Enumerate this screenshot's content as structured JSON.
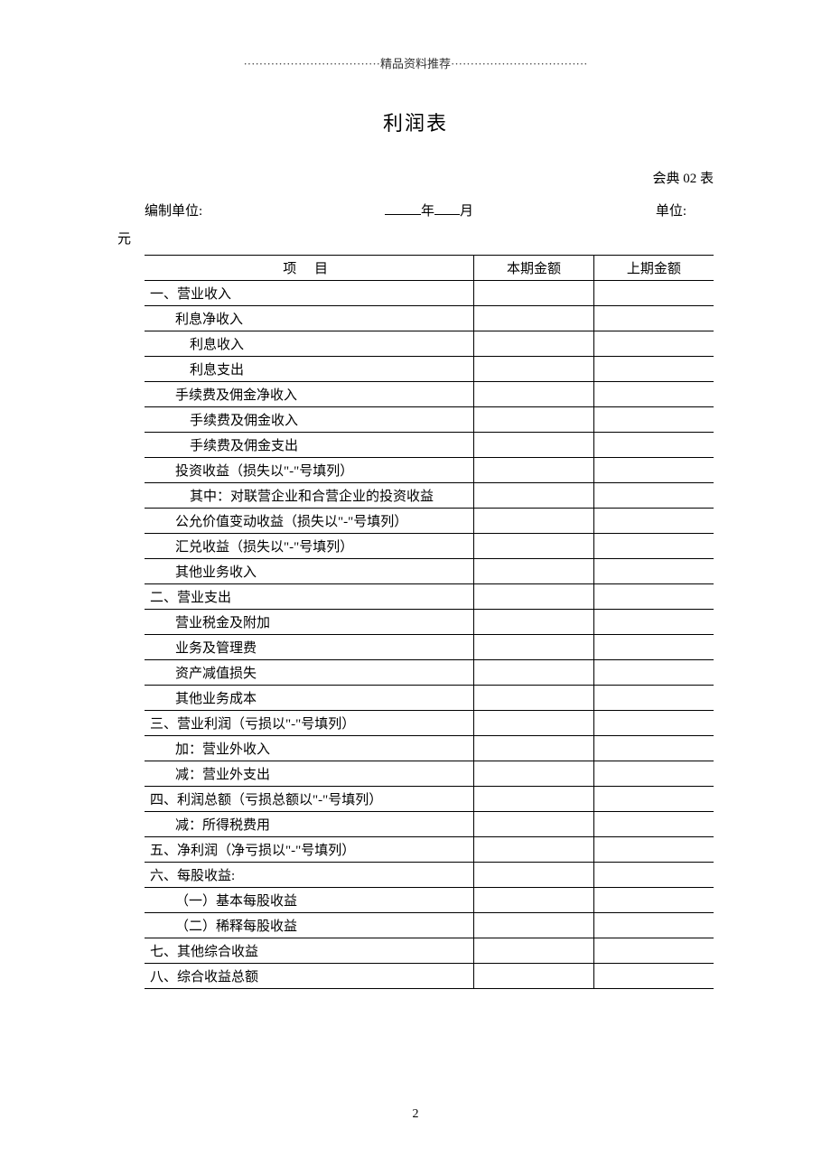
{
  "header_banner": "···································精品资料推荐···································",
  "title": "利润表",
  "form_code": "会典 02 表",
  "meta": {
    "prepared_by_label": "编制单位:",
    "year_label": "年",
    "month_label": "月",
    "unit_label": "单位:"
  },
  "currency_unit": "元",
  "table": {
    "headers": {
      "item": "项 目",
      "current": "本期金额",
      "prior": "上期金额"
    },
    "rows": [
      {
        "label": "一、营业收入",
        "indent": 0,
        "current": "",
        "prior": ""
      },
      {
        "label": "利息净收入",
        "indent": 1,
        "current": "",
        "prior": ""
      },
      {
        "label": "利息收入",
        "indent": 2,
        "current": "",
        "prior": ""
      },
      {
        "label": "利息支出",
        "indent": 2,
        "current": "",
        "prior": ""
      },
      {
        "label": "手续费及佣金净收入",
        "indent": 1,
        "current": "",
        "prior": ""
      },
      {
        "label": "手续费及佣金收入",
        "indent": 2,
        "current": "",
        "prior": ""
      },
      {
        "label": "手续费及佣金支出",
        "indent": 2,
        "current": "",
        "prior": ""
      },
      {
        "label": "投资收益（损失以\"-\"号填列）",
        "indent": 1,
        "current": "",
        "prior": ""
      },
      {
        "label": "其中：对联营企业和合营企业的投资收益",
        "indent": 2,
        "current": "",
        "prior": ""
      },
      {
        "label": "公允价值变动收益（损失以\"-\"号填列）",
        "indent": 1,
        "current": "",
        "prior": ""
      },
      {
        "label": "汇兑收益（损失以\"-\"号填列）",
        "indent": 1,
        "current": "",
        "prior": ""
      },
      {
        "label": "其他业务收入",
        "indent": 1,
        "current": "",
        "prior": ""
      },
      {
        "label": "二、营业支出",
        "indent": 0,
        "current": "",
        "prior": ""
      },
      {
        "label": "营业税金及附加",
        "indent": 1,
        "current": "",
        "prior": ""
      },
      {
        "label": "业务及管理费",
        "indent": 1,
        "current": "",
        "prior": ""
      },
      {
        "label": "资产减值损失",
        "indent": 1,
        "current": "",
        "prior": ""
      },
      {
        "label": "其他业务成本",
        "indent": 1,
        "current": "",
        "prior": ""
      },
      {
        "label": "三、营业利润（亏损以\"-\"号填列）",
        "indent": 0,
        "current": "",
        "prior": ""
      },
      {
        "label": "加：营业外收入",
        "indent": 1,
        "current": "",
        "prior": ""
      },
      {
        "label": "减：营业外支出",
        "indent": 1,
        "current": "",
        "prior": ""
      },
      {
        "label": "四、利润总额（亏损总额以\"-\"号填列）",
        "indent": 0,
        "current": "",
        "prior": ""
      },
      {
        "label": "减：所得税费用",
        "indent": 1,
        "current": "",
        "prior": ""
      },
      {
        "label": "五、净利润（净亏损以\"-\"号填列）",
        "indent": 0,
        "current": "",
        "prior": ""
      },
      {
        "label": "六、每股收益:",
        "indent": 0,
        "current": "",
        "prior": ""
      },
      {
        "label": "（一）基本每股收益",
        "indent": 1,
        "current": "",
        "prior": ""
      },
      {
        "label": "（二）稀释每股收益",
        "indent": 1,
        "current": "",
        "prior": ""
      },
      {
        "label": "七、其他综合收益",
        "indent": 0,
        "current": "",
        "prior": ""
      },
      {
        "label": "八、综合收益总额",
        "indent": 0,
        "current": "",
        "prior": ""
      }
    ]
  },
  "page_number": "2"
}
